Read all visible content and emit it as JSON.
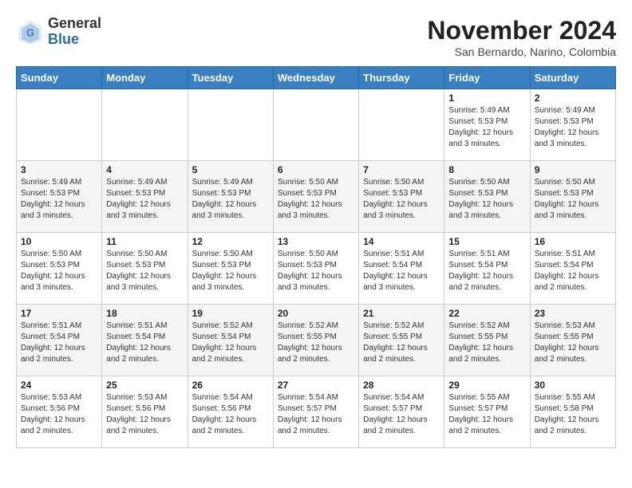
{
  "logo": {
    "general": "General",
    "blue": "Blue"
  },
  "header": {
    "month_title": "November 2024",
    "subtitle": "San Bernardo, Narino, Colombia"
  },
  "days_of_week": [
    "Sunday",
    "Monday",
    "Tuesday",
    "Wednesday",
    "Thursday",
    "Friday",
    "Saturday"
  ],
  "weeks": [
    [
      {
        "day": "",
        "info": ""
      },
      {
        "day": "",
        "info": ""
      },
      {
        "day": "",
        "info": ""
      },
      {
        "day": "",
        "info": ""
      },
      {
        "day": "",
        "info": ""
      },
      {
        "day": "1",
        "info": "Sunrise: 5:49 AM\nSunset: 5:53 PM\nDaylight: 12 hours and 3 minutes."
      },
      {
        "day": "2",
        "info": "Sunrise: 5:49 AM\nSunset: 5:53 PM\nDaylight: 12 hours and 3 minutes."
      }
    ],
    [
      {
        "day": "3",
        "info": "Sunrise: 5:49 AM\nSunset: 5:53 PM\nDaylight: 12 hours and 3 minutes."
      },
      {
        "day": "4",
        "info": "Sunrise: 5:49 AM\nSunset: 5:53 PM\nDaylight: 12 hours and 3 minutes."
      },
      {
        "day": "5",
        "info": "Sunrise: 5:49 AM\nSunset: 5:53 PM\nDaylight: 12 hours and 3 minutes."
      },
      {
        "day": "6",
        "info": "Sunrise: 5:50 AM\nSunset: 5:53 PM\nDaylight: 12 hours and 3 minutes."
      },
      {
        "day": "7",
        "info": "Sunrise: 5:50 AM\nSunset: 5:53 PM\nDaylight: 12 hours and 3 minutes."
      },
      {
        "day": "8",
        "info": "Sunrise: 5:50 AM\nSunset: 5:53 PM\nDaylight: 12 hours and 3 minutes."
      },
      {
        "day": "9",
        "info": "Sunrise: 5:50 AM\nSunset: 5:53 PM\nDaylight: 12 hours and 3 minutes."
      }
    ],
    [
      {
        "day": "10",
        "info": "Sunrise: 5:50 AM\nSunset: 5:53 PM\nDaylight: 12 hours and 3 minutes."
      },
      {
        "day": "11",
        "info": "Sunrise: 5:50 AM\nSunset: 5:53 PM\nDaylight: 12 hours and 3 minutes."
      },
      {
        "day": "12",
        "info": "Sunrise: 5:50 AM\nSunset: 5:53 PM\nDaylight: 12 hours and 3 minutes."
      },
      {
        "day": "13",
        "info": "Sunrise: 5:50 AM\nSunset: 5:53 PM\nDaylight: 12 hours and 3 minutes."
      },
      {
        "day": "14",
        "info": "Sunrise: 5:51 AM\nSunset: 5:54 PM\nDaylight: 12 hours and 3 minutes."
      },
      {
        "day": "15",
        "info": "Sunrise: 5:51 AM\nSunset: 5:54 PM\nDaylight: 12 hours and 2 minutes."
      },
      {
        "day": "16",
        "info": "Sunrise: 5:51 AM\nSunset: 5:54 PM\nDaylight: 12 hours and 2 minutes."
      }
    ],
    [
      {
        "day": "17",
        "info": "Sunrise: 5:51 AM\nSunset: 5:54 PM\nDaylight: 12 hours and 2 minutes."
      },
      {
        "day": "18",
        "info": "Sunrise: 5:51 AM\nSunset: 5:54 PM\nDaylight: 12 hours and 2 minutes."
      },
      {
        "day": "19",
        "info": "Sunrise: 5:52 AM\nSunset: 5:54 PM\nDaylight: 12 hours and 2 minutes."
      },
      {
        "day": "20",
        "info": "Sunrise: 5:52 AM\nSunset: 5:55 PM\nDaylight: 12 hours and 2 minutes."
      },
      {
        "day": "21",
        "info": "Sunrise: 5:52 AM\nSunset: 5:55 PM\nDaylight: 12 hours and 2 minutes."
      },
      {
        "day": "22",
        "info": "Sunrise: 5:52 AM\nSunset: 5:55 PM\nDaylight: 12 hours and 2 minutes."
      },
      {
        "day": "23",
        "info": "Sunrise: 5:53 AM\nSunset: 5:55 PM\nDaylight: 12 hours and 2 minutes."
      }
    ],
    [
      {
        "day": "24",
        "info": "Sunrise: 5:53 AM\nSunset: 5:56 PM\nDaylight: 12 hours and 2 minutes."
      },
      {
        "day": "25",
        "info": "Sunrise: 5:53 AM\nSunset: 5:56 PM\nDaylight: 12 hours and 2 minutes."
      },
      {
        "day": "26",
        "info": "Sunrise: 5:54 AM\nSunset: 5:56 PM\nDaylight: 12 hours and 2 minutes."
      },
      {
        "day": "27",
        "info": "Sunrise: 5:54 AM\nSunset: 5:57 PM\nDaylight: 12 hours and 2 minutes."
      },
      {
        "day": "28",
        "info": "Sunrise: 5:54 AM\nSunset: 5:57 PM\nDaylight: 12 hours and 2 minutes."
      },
      {
        "day": "29",
        "info": "Sunrise: 5:55 AM\nSunset: 5:57 PM\nDaylight: 12 hours and 2 minutes."
      },
      {
        "day": "30",
        "info": "Sunrise: 5:55 AM\nSunset: 5:58 PM\nDaylight: 12 hours and 2 minutes."
      }
    ]
  ]
}
